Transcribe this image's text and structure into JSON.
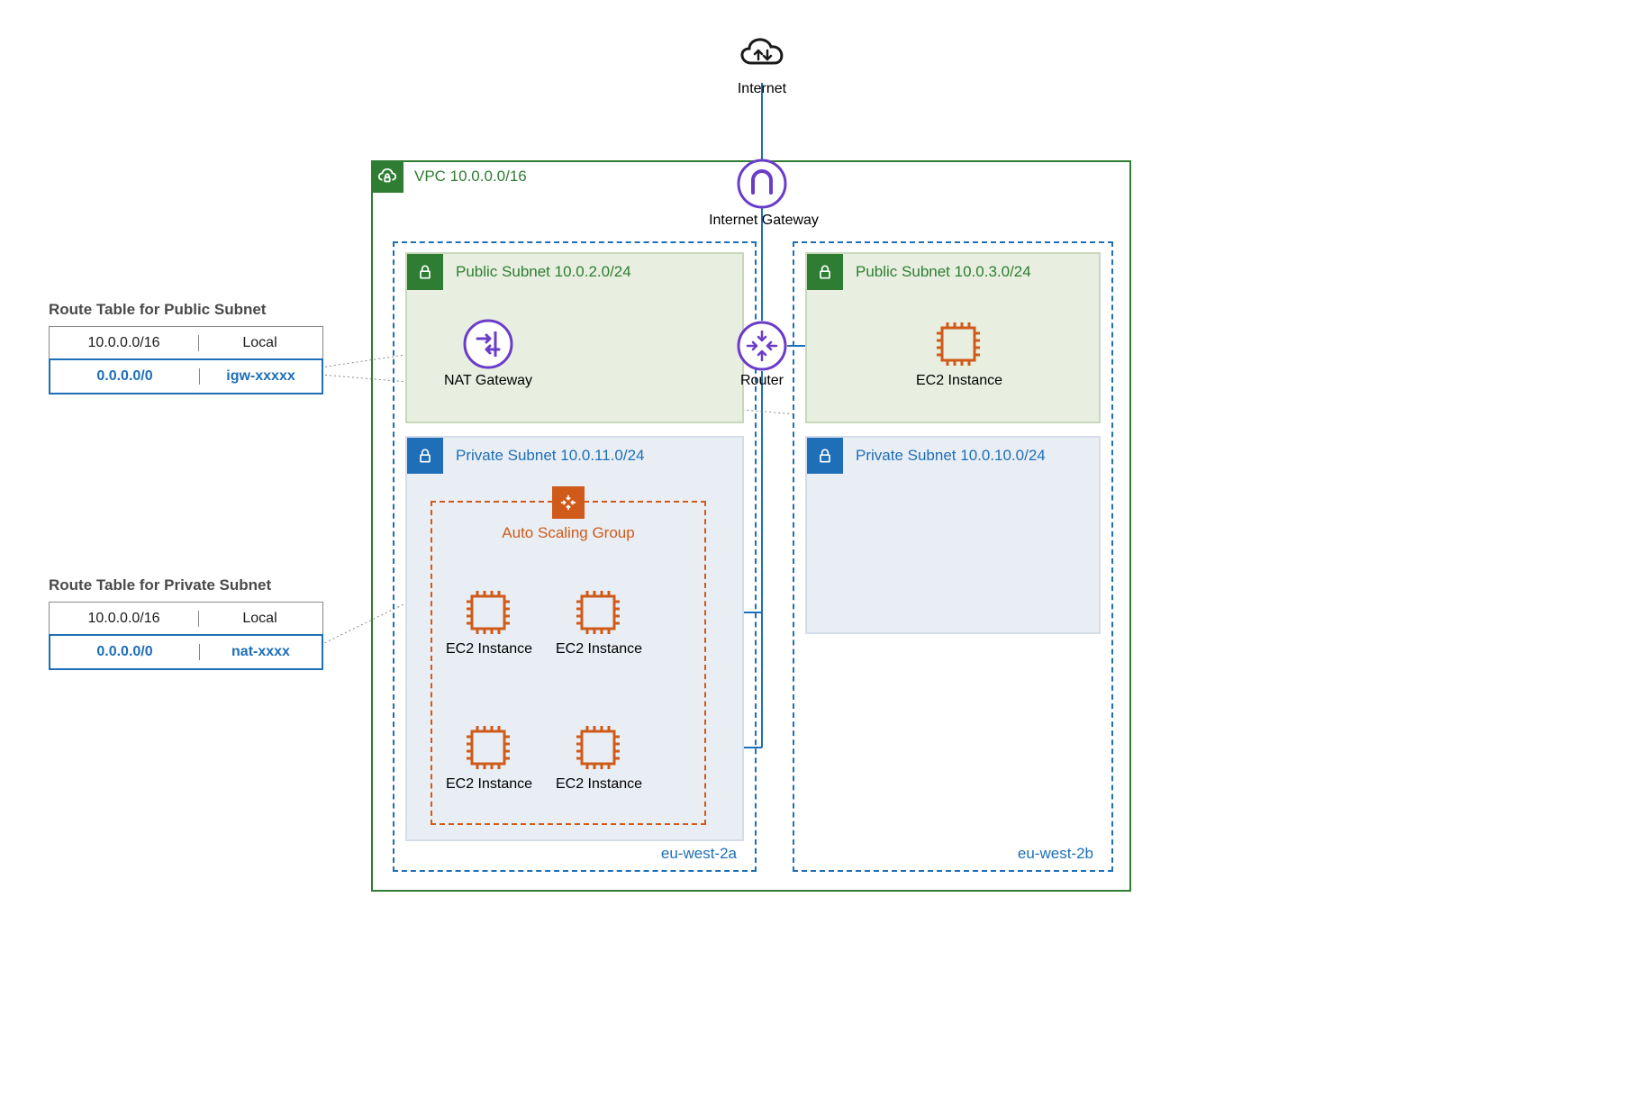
{
  "internet": {
    "label": "Internet"
  },
  "igw": {
    "label": "Internet Gateway"
  },
  "vpc": {
    "label": "VPC 10.0.0.0/16"
  },
  "router": {
    "label": "Router"
  },
  "nat": {
    "label": "NAT Gateway"
  },
  "asg": {
    "label": "Auto Scaling Group"
  },
  "ec2": {
    "label": "EC2 Instance"
  },
  "azA": {
    "name": "eu-west-2a",
    "public": {
      "label": "Public Subnet 10.0.2.0/24"
    },
    "private": {
      "label": "Private Subnet 10.0.11.0/24"
    }
  },
  "azB": {
    "name": "eu-west-2b",
    "public": {
      "label": "Public Subnet 10.0.3.0/24"
    },
    "private": {
      "label": "Private Subnet 10.0.10.0/24"
    }
  },
  "routePublic": {
    "title": "Route Table for Public Subnet",
    "rows": [
      {
        "dest": "10.0.0.0/16",
        "target": "Local"
      },
      {
        "dest": "0.0.0.0/0",
        "target": "igw-xxxxx"
      }
    ]
  },
  "routePrivate": {
    "title": "Route Table for Private Subnet",
    "rows": [
      {
        "dest": "10.0.0.0/16",
        "target": "Local"
      },
      {
        "dest": "0.0.0.0/0",
        "target": "nat-xxxx"
      }
    ]
  }
}
